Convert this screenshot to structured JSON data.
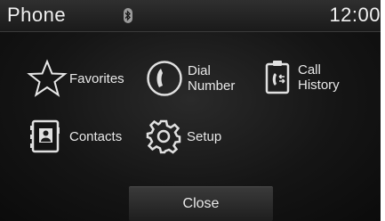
{
  "status_bar": {
    "title": "Phone",
    "time": "12:00"
  },
  "menu": {
    "favorites": "Favorites",
    "dial_number_line1": "Dial",
    "dial_number_line2": "Number",
    "call_history_line1": "Call",
    "call_history_line2": "History",
    "contacts": "Contacts",
    "setup": "Setup"
  },
  "close_label": "Close",
  "icons": [
    "bluetooth-icon",
    "star-icon",
    "handset-icon",
    "call-history-icon",
    "contacts-icon",
    "gear-icon"
  ]
}
